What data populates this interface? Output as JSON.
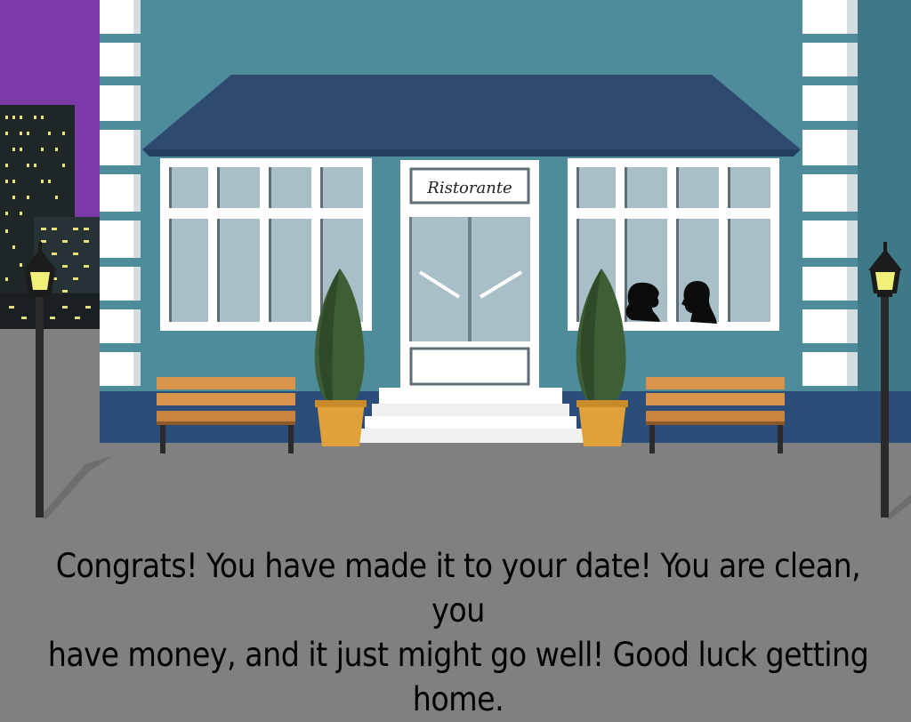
{
  "scene": {
    "sign_text": "Ristorante",
    "colors": {
      "sky": "#7b3aa8",
      "building": "#4e8c9c",
      "roof": "#2e4a6e",
      "base": "#2b4d7a",
      "window_frame": "#ffffff",
      "glass": "#a9bfc8",
      "street": "#808080",
      "bench_wood": "#d9934a",
      "pot": "#e0a03a",
      "plant": "#3e5f35",
      "lamp_glow": "#f3f07a"
    },
    "icons": [
      "street-lamp-icon",
      "bench-icon",
      "potted-plant-icon",
      "couple-silhouette-icon",
      "city-skyline-icon"
    ]
  },
  "message": {
    "line1": "Congrats! You have made it to your date! You are clean, you",
    "line2": "have money, and it just might go well! Good luck getting home."
  }
}
